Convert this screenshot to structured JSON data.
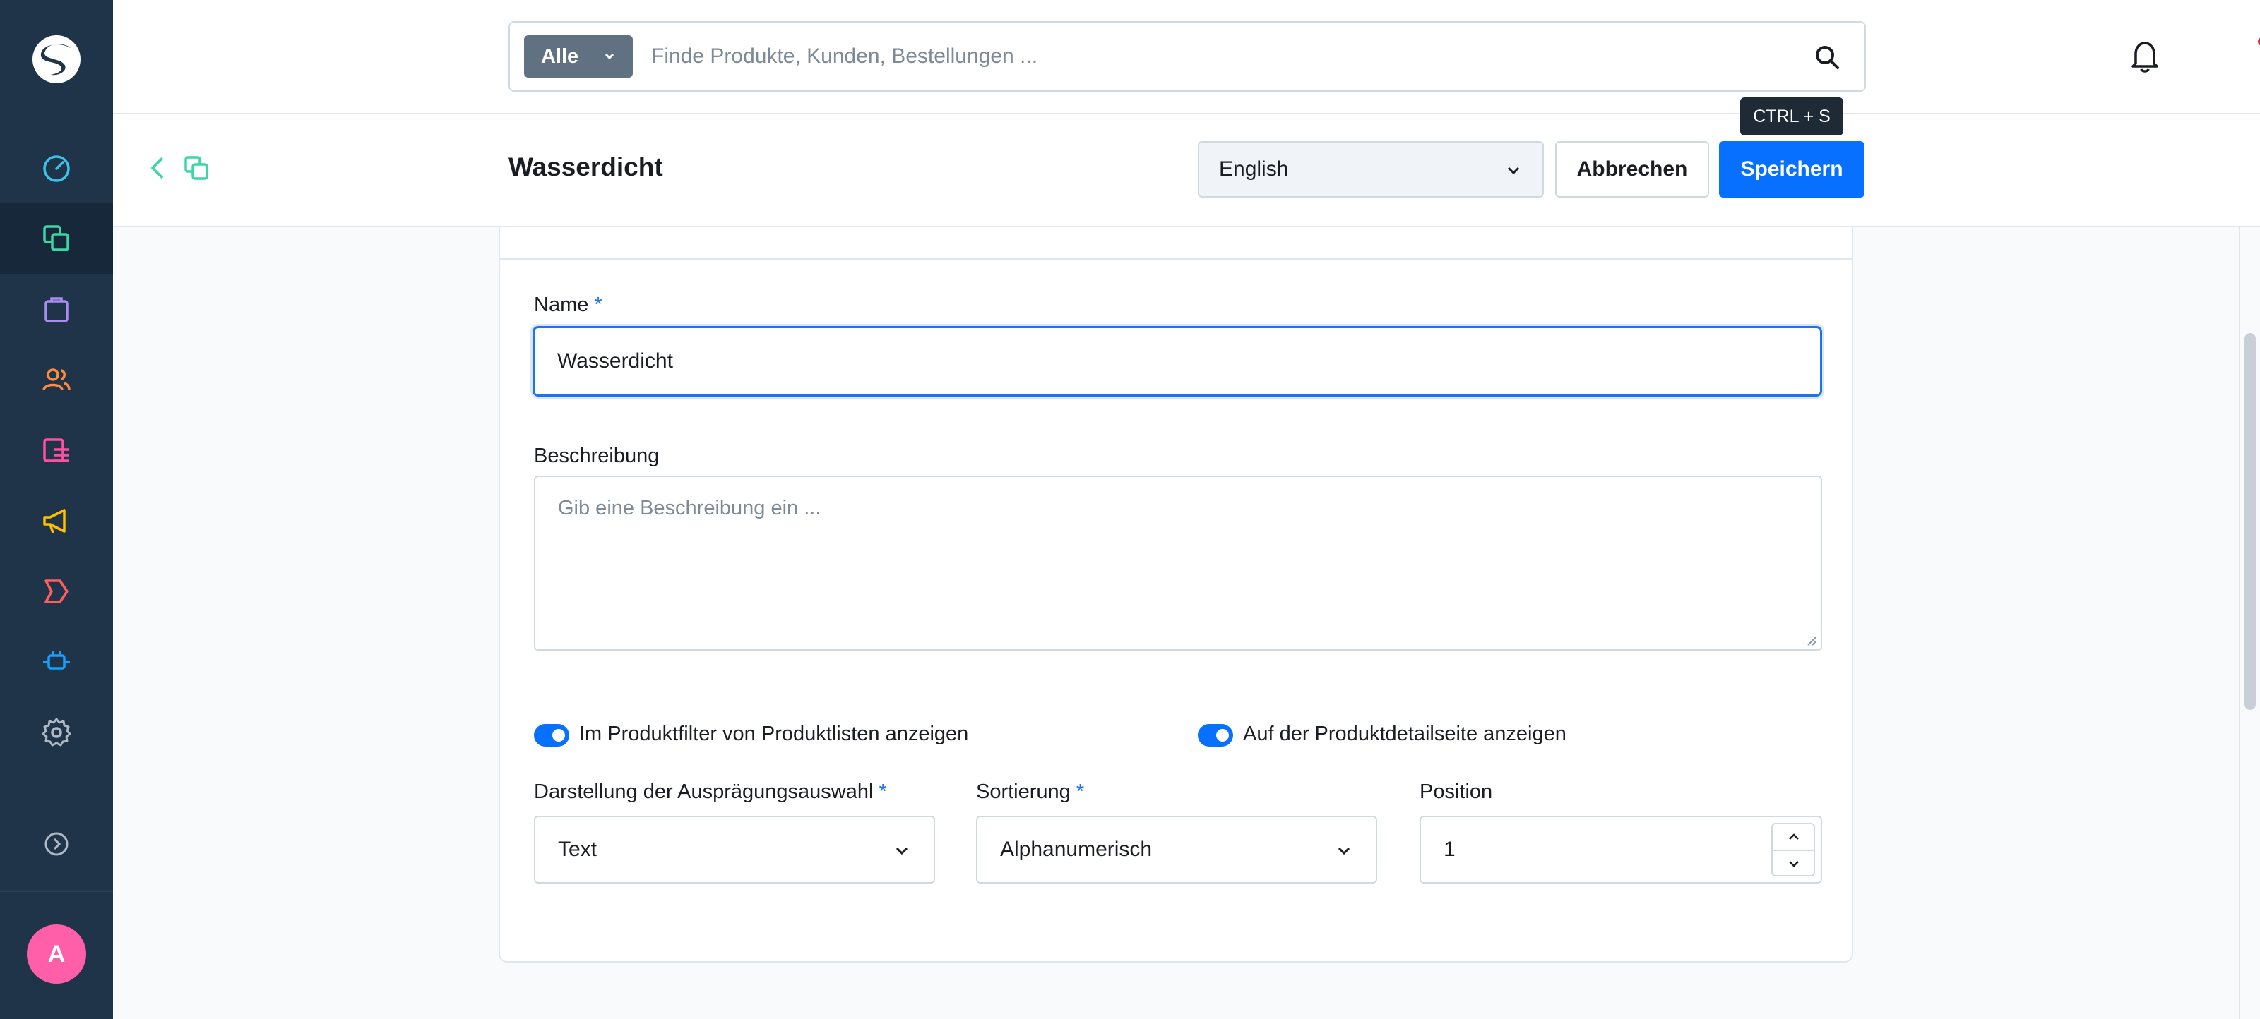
{
  "sidebar": {
    "avatar_initial": "A",
    "icons": [
      "dashboard-icon",
      "catalogue-icon",
      "orders-icon",
      "customers-icon",
      "content-icon",
      "marketing-icon",
      "extensions-icon",
      "plugins-icon",
      "settings-icon",
      "expand-icon"
    ]
  },
  "topbar": {
    "search_type": "Alle",
    "search_placeholder": "Finde Produkte, Kunden, Bestellungen ...",
    "tooltip": "CTRL + S"
  },
  "smartbar": {
    "title": "Wasserdicht",
    "language": "English",
    "cancel_label": "Abbrechen",
    "save_label": "Speichern"
  },
  "form": {
    "name_label": "Name",
    "name_value": "Wasserdicht",
    "required_mark": "*",
    "description_label": "Beschreibung",
    "description_placeholder": "Gib eine Beschreibung ein ...",
    "toggle_filter_label": "Im Produktfilter von Produktlisten anzeigen",
    "toggle_filter_on": true,
    "toggle_detail_label": "Auf der Produktdetailseite anzeigen",
    "toggle_detail_on": true,
    "display_type_label": "Darstellung der Ausprägungsauswahl",
    "display_type_value": "Text",
    "sorting_label": "Sortierung",
    "sorting_value": "Alphanumerisch",
    "position_label": "Position",
    "position_value": "1"
  },
  "colors": {
    "sidebar_bg": "#1f3349",
    "primary": "#0870ff",
    "avatar": "#ff5fa8",
    "notification_dot": "#de294c"
  }
}
